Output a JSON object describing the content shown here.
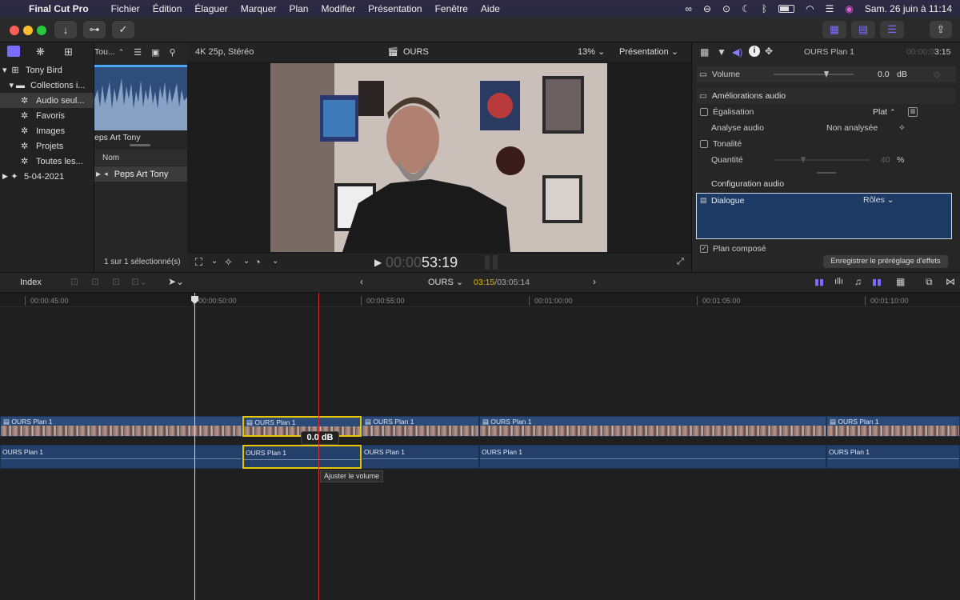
{
  "menubar": {
    "apple": "",
    "app_name": "Final Cut Pro",
    "items": [
      "Fichier",
      "Édition",
      "Élaguer",
      "Marquer",
      "Plan",
      "Modifier",
      "Présentation",
      "Fenêtre",
      "Aide"
    ],
    "clock": "Sam. 26 juin à  11:14"
  },
  "library": {
    "items": [
      {
        "label": "Tony Bird",
        "icon": "library-icon",
        "indent": 0,
        "disclosure": "▼"
      },
      {
        "label": "Collections i...",
        "icon": "folder-icon",
        "indent": 1,
        "disclosure": "▼"
      },
      {
        "label": "Audio seul...",
        "icon": "gear-icon",
        "indent": 2,
        "selected": true
      },
      {
        "label": "Favoris",
        "icon": "gear-icon",
        "indent": 2
      },
      {
        "label": "Images",
        "icon": "gear-icon",
        "indent": 2
      },
      {
        "label": "Projets",
        "icon": "gear-icon",
        "indent": 2
      },
      {
        "label": "Toutes les...",
        "icon": "gear-icon",
        "indent": 2
      },
      {
        "label": "5-04-2021",
        "icon": "event-star-icon",
        "indent": 0,
        "disclosure": "▶"
      }
    ]
  },
  "browser": {
    "filter_label": "Tou...",
    "clip_name": "eps Art Tony",
    "column_header": "Nom",
    "list_item": "Peps Art Tony",
    "status": "1 sur 1 sélectionné(s)"
  },
  "viewer": {
    "format": "4K 25p, Stéréo",
    "project": "OURS",
    "zoom": "13%",
    "presentation": "Présentation",
    "timecode_dim": "00:00",
    "timecode": "53:19"
  },
  "inspector": {
    "clip_name": "OURS Plan 1",
    "clip_duration_dim": "00:00:0",
    "clip_duration": "3:15",
    "volume_label": "Volume",
    "volume_value": "0.0",
    "volume_unit": "dB",
    "enhancements_label": "Améliorations audio",
    "eq_label": "Égalisation",
    "eq_value": "Plat",
    "analysis_label": "Analyse audio",
    "analysis_value": "Non analysée",
    "tone_label": "Tonalité",
    "amount_label": "Quantité",
    "amount_value": "40",
    "amount_unit": "%",
    "config_label": "Configuration audio",
    "dialogue_label": "Dialogue",
    "roles_label": "Rôles",
    "compound_label": "Plan composé",
    "save_preset": "Enregistrer le préréglage d'effets"
  },
  "timeline_toolbar": {
    "index": "Index",
    "project": "OURS",
    "position": "03:15",
    "total": "/03:05:14"
  },
  "ruler": [
    "00:00:45:00",
    "00:00:50:00",
    "00:00:55:00",
    "00:01:00:00",
    "00:01:05:00",
    "00:01:10:00"
  ],
  "clips": {
    "video_label": "OURS Plan 1",
    "audio_label": "OURS Plan 1",
    "volume_readout": "0.0 dB",
    "tooltip": "Ajuster le volume"
  },
  "colors": {
    "accent": "#7a6cff",
    "selection": "#e6c600",
    "playhead": "#d03030",
    "clip_blue": "#2b4a78"
  }
}
